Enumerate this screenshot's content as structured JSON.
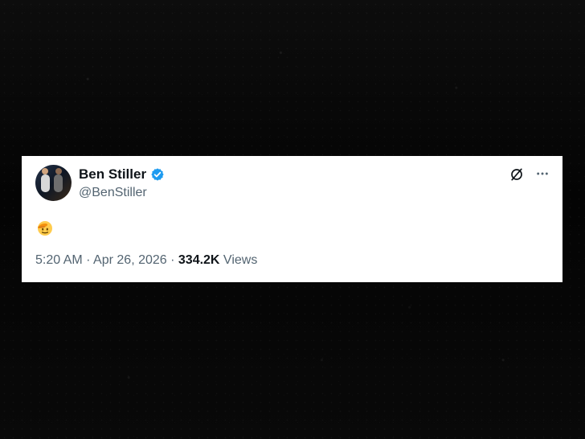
{
  "tweet": {
    "display_name": "Ben Stiller",
    "handle": "@BenStiller",
    "time": "5:20 AM",
    "separator_1": " · ",
    "date": "Apr 26, 2026",
    "separator_2": " · ",
    "views_count": "334.2K",
    "views_label": " Views",
    "content_emoji": "saluting-face-emoji"
  },
  "colors": {
    "background": "#060606",
    "card": "#ffffff",
    "name_text": "#0f1419",
    "secondary_text": "#536471",
    "verified_badge": "#1d9bf0"
  },
  "icons": {
    "verified": "verified-badge-icon",
    "grok": "grok-icon",
    "more": "more-options-icon"
  }
}
